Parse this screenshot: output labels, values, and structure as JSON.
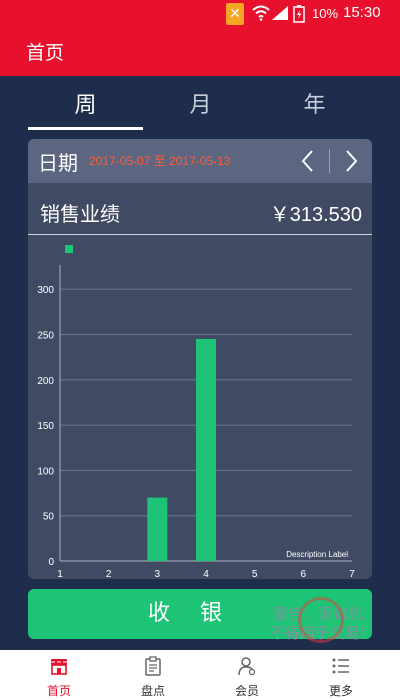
{
  "status_bar": {
    "battery": "10%",
    "time": "15:30"
  },
  "header": {
    "title": "首页"
  },
  "tabs": [
    {
      "label": "周",
      "active": true
    },
    {
      "label": "月",
      "active": false
    },
    {
      "label": "年",
      "active": false
    }
  ],
  "date_row": {
    "label": "日期",
    "range": "2017-05-07 至 2017-05-13",
    "prev_icon": "chevron-left-icon",
    "next_icon": "chevron-right-icon"
  },
  "sales": {
    "label": "销售业绩",
    "value": "￥313.530"
  },
  "chart_data": {
    "type": "bar",
    "categories": [
      "1",
      "2",
      "3",
      "4",
      "5",
      "6",
      "7"
    ],
    "series": [
      {
        "values": [
          0,
          0,
          70,
          245,
          0,
          0,
          0
        ],
        "color": "#1ec476"
      }
    ],
    "ylim": [
      0,
      320
    ],
    "yticks": [
      "0",
      "50",
      "100",
      "150",
      "200",
      "250",
      "300"
    ],
    "description_label": "Description Label",
    "grid": true,
    "legend": "top-left"
  },
  "cashier_button": {
    "label": "收银"
  },
  "watermark": {
    "line1": "警告：调试机",
    "line2": "不得用于交易!"
  },
  "bottom_nav": [
    {
      "label": "首页",
      "icon": "store-icon",
      "active": true
    },
    {
      "label": "盘点",
      "icon": "clipboard-icon",
      "active": false
    },
    {
      "label": "会员",
      "icon": "member-icon",
      "active": false
    },
    {
      "label": "更多",
      "icon": "list-icon",
      "active": false
    }
  ],
  "colors": {
    "brand_red": "#e8112d",
    "background": "#1f2d4c",
    "accent_green": "#1ec476",
    "date_orange": "#ff5a36"
  }
}
